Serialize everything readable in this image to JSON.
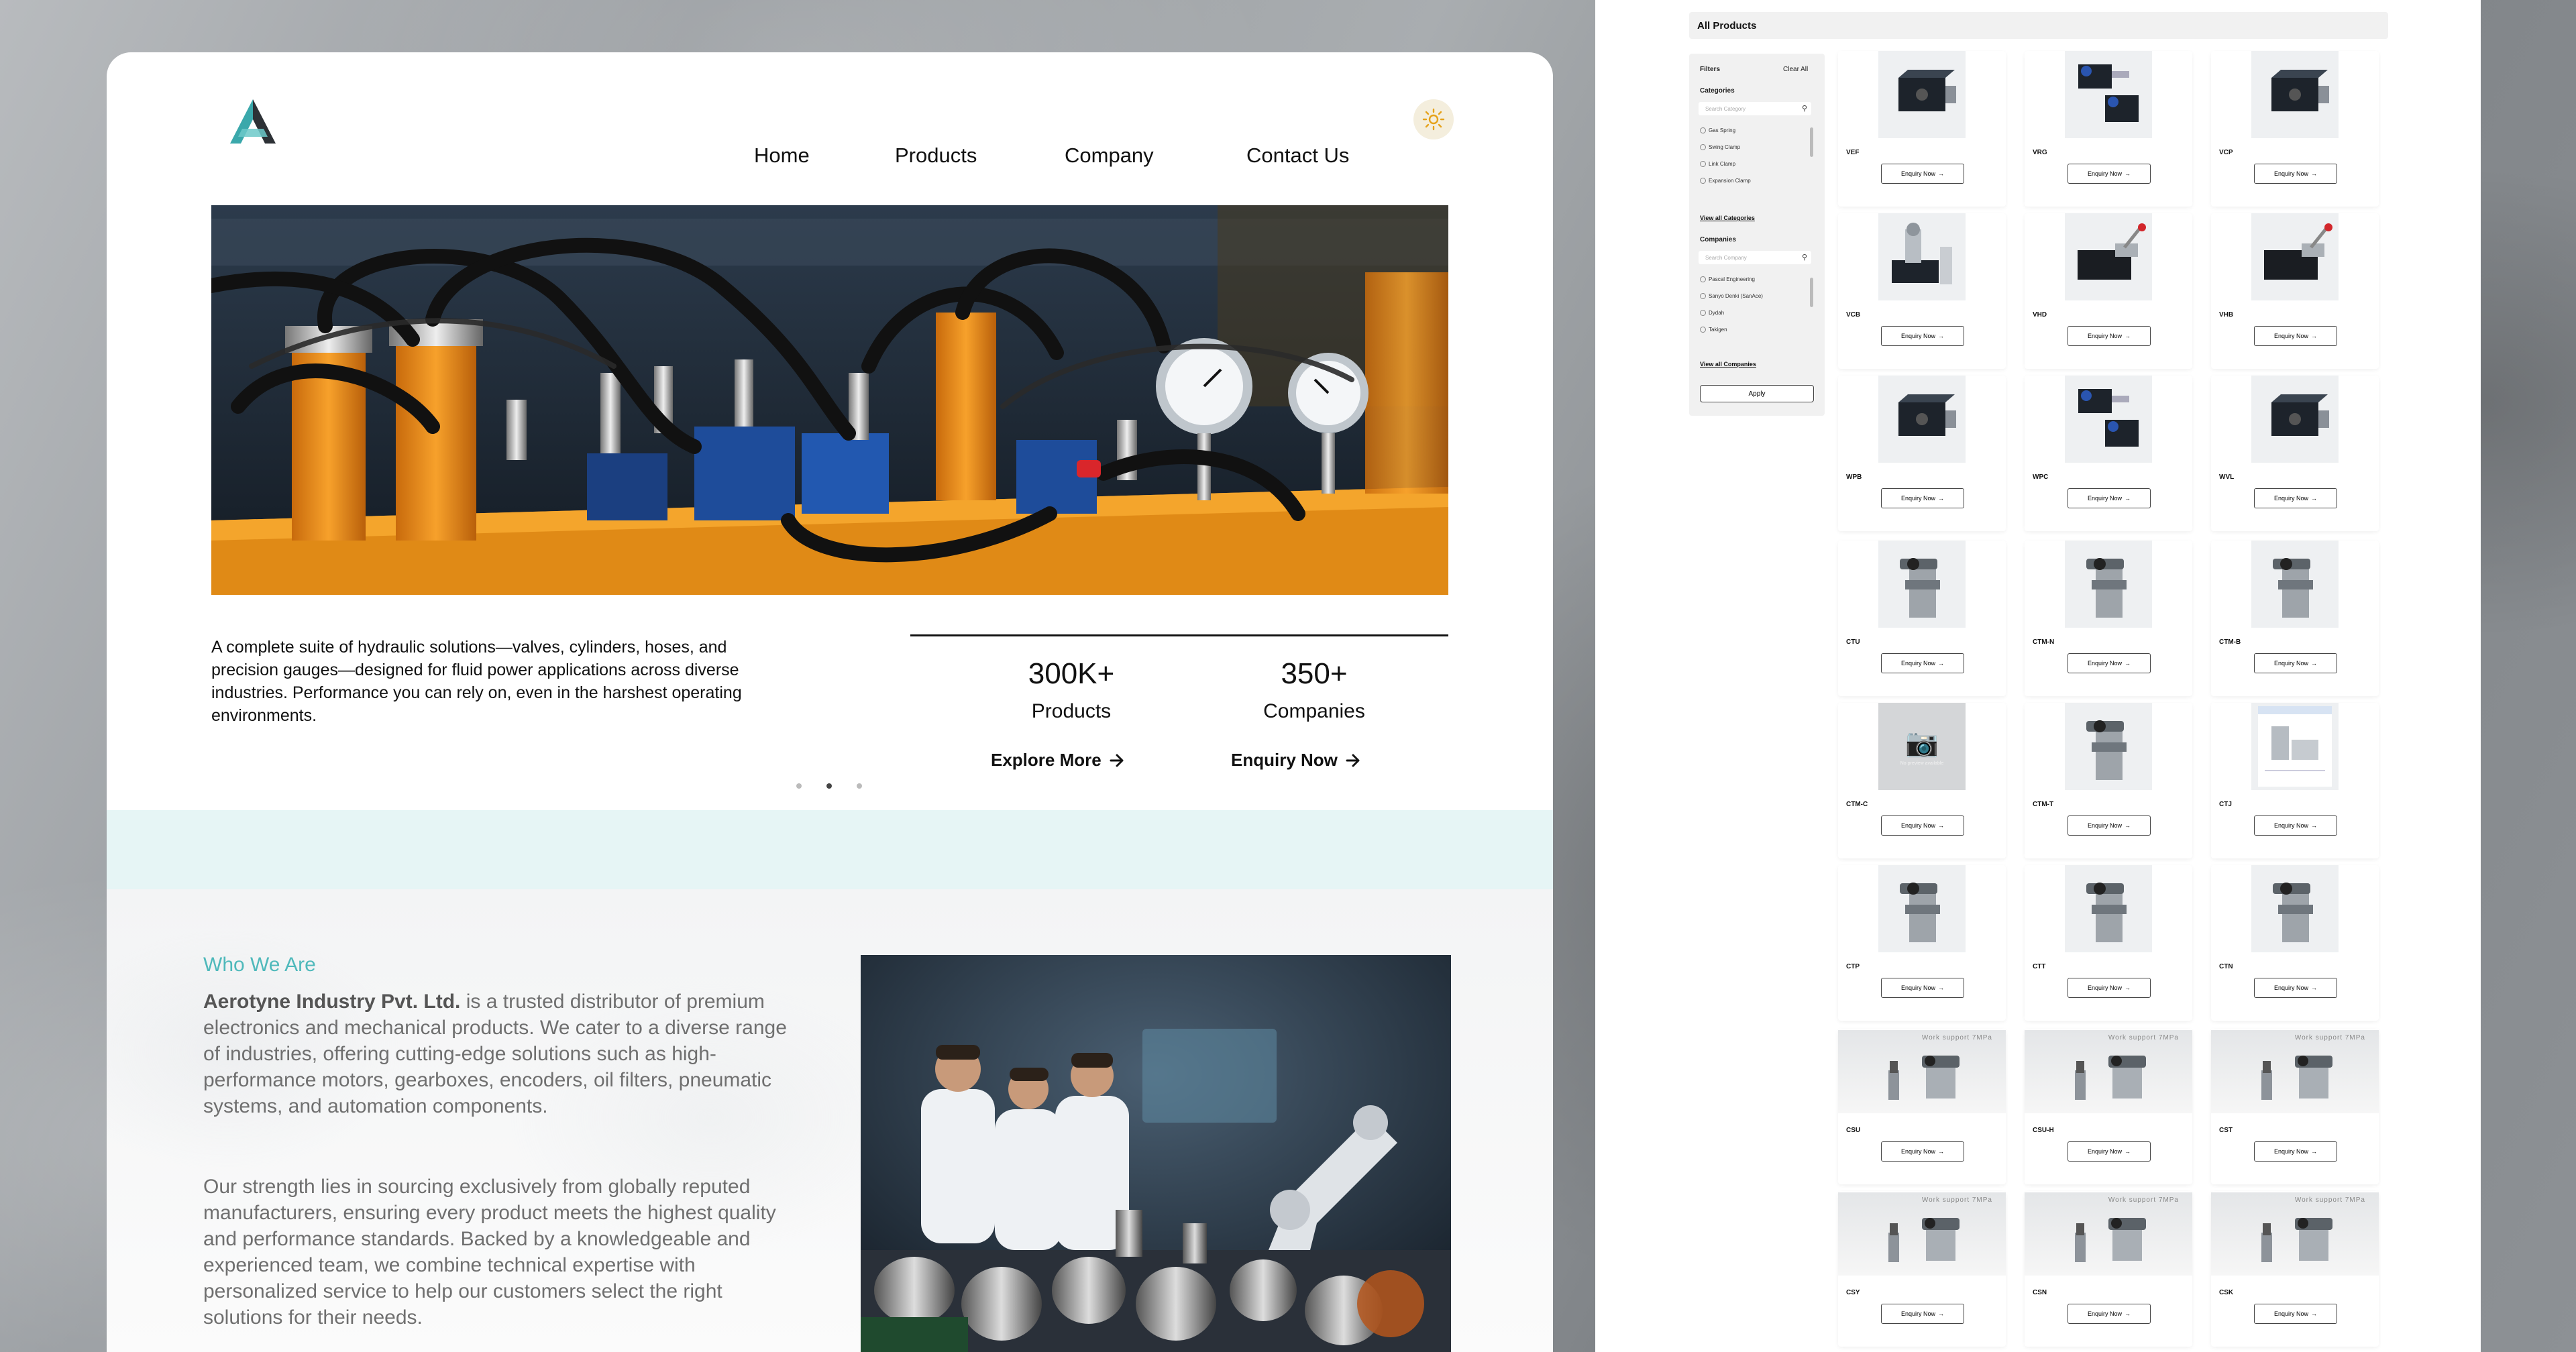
{
  "site": {
    "nav": {
      "home": "Home",
      "products": "Products",
      "company": "Company",
      "contact": "Contact Us"
    },
    "hero": {
      "description": "A complete suite of hydraulic solutions—valves, cylinders, hoses, and precision gauges—designed for fluid power applications across diverse industries. Performance you can rely on, even in the harshest operating environments.",
      "stats": [
        {
          "value": "300K+",
          "label": "Products",
          "link": "Explore More"
        },
        {
          "value": "350+",
          "label": "Companies",
          "link": "Enquiry Now"
        }
      ],
      "carousel_active_index": 1
    },
    "who": {
      "heading": "Who We Are",
      "company_name": "Aerotyne Industry Pvt. Ltd.",
      "para1_rest": " is a trusted distributor of premium electronics and mechanical products. We cater to a diverse range of industries, offering cutting-edge solutions such as high-performance motors, gearboxes, encoders, oil filters, pneumatic systems, and automation components.",
      "para2": "Our strength lies in sourcing exclusively from globally reputed manufacturers, ensuring every product meets the highest quality and performance standards. Backed by a knowledgeable and experienced team, we combine technical expertise with personalized service to help our customers select the right solutions for their needs."
    },
    "colors": {
      "accent": "#4fb9bb",
      "teal_band": "#e6f5f5",
      "hose_orange": "#f39a1e"
    }
  },
  "catalog": {
    "title": "All Products",
    "filters": {
      "title": "Filters",
      "clear": "Clear All",
      "categories_label": "Categories",
      "category_search_placeholder": "Search Category",
      "categories": [
        "Gas Spring",
        "Swing Clamp",
        "Link Clamp",
        "Expansion Clamp"
      ],
      "view_all_categories": "View all Categories",
      "companies_label": "Companies",
      "company_search_placeholder": "Search Company",
      "companies": [
        "Pascal Engineering",
        "Sanyo Denki (SanAce)",
        "Dydah",
        "Takigen"
      ],
      "view_all_companies": "View all Companies",
      "apply": "Apply"
    },
    "enquiry_label": "Enquiry Now",
    "no_preview": "No preview available",
    "work_support": "Work support",
    "pressure": "7MPa",
    "products": [
      {
        "name": "VEF",
        "kind": "block"
      },
      {
        "name": "VRG",
        "kind": "valve2"
      },
      {
        "name": "VCP",
        "kind": "block"
      },
      {
        "name": "VCB",
        "kind": "valve"
      },
      {
        "name": "VHD",
        "kind": "lever"
      },
      {
        "name": "VHB",
        "kind": "lever"
      },
      {
        "name": "WPB",
        "kind": "block"
      },
      {
        "name": "WPC",
        "kind": "valve2"
      },
      {
        "name": "WVL",
        "kind": "block"
      },
      {
        "name": "CTU",
        "kind": "clamp"
      },
      {
        "name": "CTM-N",
        "kind": "clamp"
      },
      {
        "name": "CTM-B",
        "kind": "clamp"
      },
      {
        "name": "CTM-C",
        "kind": "none"
      },
      {
        "name": "CTM-T",
        "kind": "clamp"
      },
      {
        "name": "CTJ",
        "kind": "doc"
      },
      {
        "name": "CTP",
        "kind": "clamp"
      },
      {
        "name": "CTT",
        "kind": "clamp"
      },
      {
        "name": "CTN",
        "kind": "clamp"
      },
      {
        "name": "CSU",
        "kind": "work"
      },
      {
        "name": "CSU-H",
        "kind": "work"
      },
      {
        "name": "CST",
        "kind": "work"
      },
      {
        "name": "CSY",
        "kind": "work"
      },
      {
        "name": "CSN",
        "kind": "work"
      },
      {
        "name": "CSK",
        "kind": "work"
      }
    ]
  }
}
